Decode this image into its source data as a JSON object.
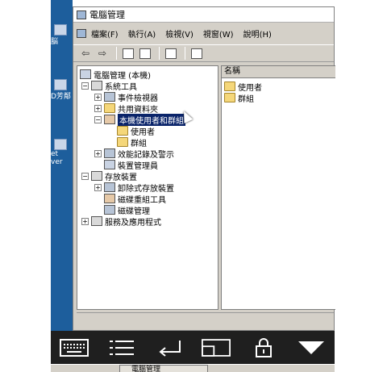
{
  "desktop": {
    "icons": [
      {
        "label": "脳"
      },
      {
        "label": "D芳鄰"
      },
      {
        "label": "et"
      },
      {
        "label": "ver"
      }
    ]
  },
  "window": {
    "title": "電腦管理",
    "menu": [
      "檔案(F)",
      "執行(A)",
      "檢視(V)",
      "視窗(W)",
      "說明(H)"
    ]
  },
  "tree": {
    "root": "電腦管理 (本機)",
    "nodes": [
      {
        "label": "系統工具",
        "level": 1,
        "expander": "−"
      },
      {
        "label": "事件檢視器",
        "level": 2,
        "expander": "+"
      },
      {
        "label": "共用資料夾",
        "level": 2,
        "expander": "+"
      },
      {
        "label": "本機使用者和群組",
        "level": 2,
        "expander": "−",
        "selected": true
      },
      {
        "label": "使用者",
        "level": 3,
        "expander": ""
      },
      {
        "label": "群組",
        "level": 3,
        "expander": ""
      },
      {
        "label": "效能記錄及警示",
        "level": 2,
        "expander": "+"
      },
      {
        "label": "裝置管理員",
        "level": 2,
        "expander": ""
      },
      {
        "label": "存放裝置",
        "level": 1,
        "expander": "−"
      },
      {
        "label": "卸除式存放裝置",
        "level": 2,
        "expander": "+"
      },
      {
        "label": "磁碟重組工具",
        "level": 2,
        "expander": ""
      },
      {
        "label": "磁碟管理",
        "level": 2,
        "expander": ""
      },
      {
        "label": "服務及應用程式",
        "level": 1,
        "expander": "+"
      }
    ]
  },
  "list": {
    "column": "名稱",
    "items": [
      "使用者",
      "群組"
    ]
  },
  "taskbar": {
    "task_label": "電腦管理"
  },
  "colors": {
    "selection": "#0a246a",
    "desktop": "#1d5e9c",
    "window_face": "#d4d0c8",
    "control_bar": "#1f1f1f"
  }
}
